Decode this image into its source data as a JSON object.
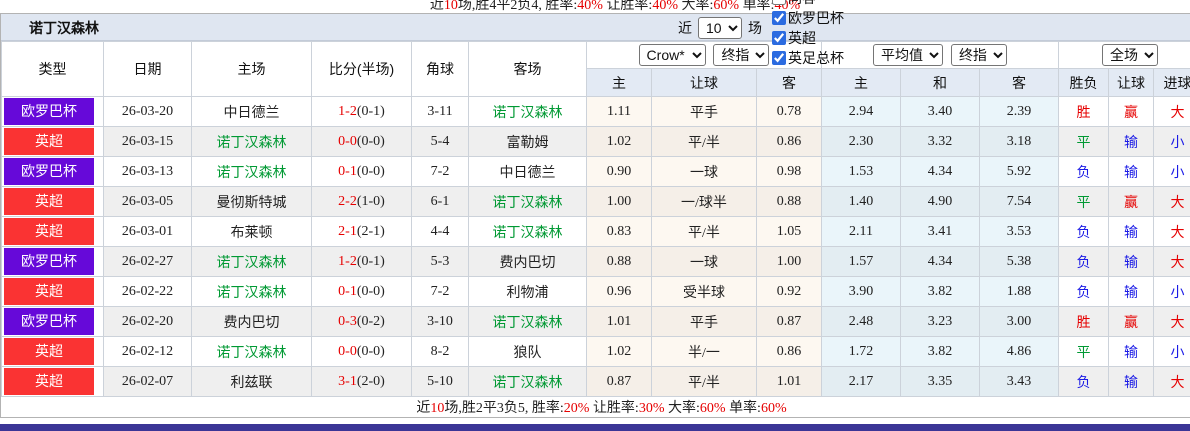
{
  "colors": {
    "league_europa": "#6609d9",
    "league_premier": "#fa3333",
    "focus_team_green": "#009933",
    "score_red": "#e60000",
    "result_red": "#e60000",
    "result_green": "#009933",
    "result_blue": "#1a1ae6",
    "header_bg": "#e3eaf4",
    "title_bar_bg": "#dfe6f1",
    "alt_row_bg": "#efefef",
    "crow_col_bg": "#fdf8f1",
    "avg_col_bg": "#eaf5fa",
    "bottom_bar": "#3b3596"
  },
  "top_clipped_line": {
    "segments": [
      {
        "t": "近",
        "c": "k"
      },
      {
        "t": "10",
        "c": "r"
      },
      {
        "t": "场,胜4平2负4, 胜率:",
        "c": "k"
      },
      {
        "t": "40%",
        "c": "r"
      },
      {
        "t": " 让胜率:",
        "c": "k"
      },
      {
        "t": "40%",
        "c": "r"
      },
      {
        "t": " 大率:",
        "c": "k"
      },
      {
        "t": "60%",
        "c": "r"
      },
      {
        "t": " 单率:",
        "c": "k"
      },
      {
        "t": "40%",
        "c": "r"
      }
    ]
  },
  "title_bar": {
    "team_name": "诺丁汉森林",
    "recent_label": "近",
    "recent_value": "10",
    "matches_label": "场",
    "checkboxes": [
      {
        "name": "same-away",
        "label": "同客",
        "checked": false
      },
      {
        "name": "europa-cup",
        "label": "欧罗巴杯",
        "checked": true
      },
      {
        "name": "premier-league",
        "label": "英超",
        "checked": true
      },
      {
        "name": "fa-cup",
        "label": "英足总杯",
        "checked": true
      }
    ]
  },
  "selects": {
    "bookmaker": "Crow*",
    "bookmaker_stage": "终指",
    "average": "平均值",
    "average_stage": "终指",
    "scope": "全场"
  },
  "columns": {
    "left": [
      "类型",
      "日期",
      "主场",
      "比分(半场)",
      "角球",
      "客场"
    ],
    "sub": [
      "主",
      "让球",
      "客",
      "主",
      "和",
      "客",
      "胜负",
      "让球",
      "进球"
    ]
  },
  "rows": [
    {
      "league": "欧罗巴杯",
      "lt": "europa",
      "date": "26-03-20",
      "home": "中日德兰",
      "home_focus": false,
      "ft": "1-2",
      "ht": "(0-1)",
      "corners": "3-11",
      "away": "诺丁汉森林",
      "away_focus": true,
      "crow": [
        "1.11",
        "平手",
        "0.78"
      ],
      "avg": [
        "2.94",
        "3.40",
        "2.39"
      ],
      "res": [
        [
          "胜",
          "red"
        ],
        [
          "赢",
          "red"
        ],
        [
          "大",
          "red"
        ]
      ]
    },
    {
      "league": "英超",
      "lt": "epl",
      "date": "26-03-15",
      "home": "诺丁汉森林",
      "home_focus": true,
      "ft": "0-0",
      "ht": "(0-0)",
      "corners": "5-4",
      "away": "富勒姆",
      "away_focus": false,
      "crow": [
        "1.02",
        "平/半",
        "0.86"
      ],
      "avg": [
        "2.30",
        "3.32",
        "3.18"
      ],
      "res": [
        [
          "平",
          "green"
        ],
        [
          "输",
          "blue"
        ],
        [
          "小",
          "blue"
        ]
      ]
    },
    {
      "league": "欧罗巴杯",
      "lt": "europa",
      "date": "26-03-13",
      "home": "诺丁汉森林",
      "home_focus": true,
      "ft": "0-1",
      "ht": "(0-0)",
      "corners": "7-2",
      "away": "中日德兰",
      "away_focus": false,
      "crow": [
        "0.90",
        "一球",
        "0.98"
      ],
      "avg": [
        "1.53",
        "4.34",
        "5.92"
      ],
      "res": [
        [
          "负",
          "blue"
        ],
        [
          "输",
          "blue"
        ],
        [
          "小",
          "blue"
        ]
      ]
    },
    {
      "league": "英超",
      "lt": "epl",
      "date": "26-03-05",
      "home": "曼彻斯特城",
      "home_focus": false,
      "ft": "2-2",
      "ht": "(1-0)",
      "corners": "6-1",
      "away": "诺丁汉森林",
      "away_focus": true,
      "crow": [
        "1.00",
        "一/球半",
        "0.88"
      ],
      "avg": [
        "1.40",
        "4.90",
        "7.54"
      ],
      "res": [
        [
          "平",
          "green"
        ],
        [
          "赢",
          "red"
        ],
        [
          "大",
          "red"
        ]
      ]
    },
    {
      "league": "英超",
      "lt": "epl",
      "date": "26-03-01",
      "home": "布莱顿",
      "home_focus": false,
      "ft": "2-1",
      "ht": "(2-1)",
      "corners": "4-4",
      "away": "诺丁汉森林",
      "away_focus": true,
      "crow": [
        "0.83",
        "平/半",
        "1.05"
      ],
      "avg": [
        "2.11",
        "3.41",
        "3.53"
      ],
      "res": [
        [
          "负",
          "blue"
        ],
        [
          "输",
          "blue"
        ],
        [
          "大",
          "red"
        ]
      ]
    },
    {
      "league": "欧罗巴杯",
      "lt": "europa",
      "date": "26-02-27",
      "home": "诺丁汉森林",
      "home_focus": true,
      "ft": "1-2",
      "ht": "(0-1)",
      "corners": "5-3",
      "away": "费内巴切",
      "away_focus": false,
      "crow": [
        "0.88",
        "一球",
        "1.00"
      ],
      "avg": [
        "1.57",
        "4.34",
        "5.38"
      ],
      "res": [
        [
          "负",
          "blue"
        ],
        [
          "输",
          "blue"
        ],
        [
          "大",
          "red"
        ]
      ]
    },
    {
      "league": "英超",
      "lt": "epl",
      "date": "26-02-22",
      "home": "诺丁汉森林",
      "home_focus": true,
      "ft": "0-1",
      "ht": "(0-0)",
      "corners": "7-2",
      "away": "利物浦",
      "away_focus": false,
      "crow": [
        "0.96",
        "受半球",
        "0.92"
      ],
      "avg": [
        "3.90",
        "3.82",
        "1.88"
      ],
      "res": [
        [
          "负",
          "blue"
        ],
        [
          "输",
          "blue"
        ],
        [
          "小",
          "blue"
        ]
      ]
    },
    {
      "league": "欧罗巴杯",
      "lt": "europa",
      "date": "26-02-20",
      "home": "费内巴切",
      "home_focus": false,
      "ft": "0-3",
      "ht": "(0-2)",
      "corners": "3-10",
      "away": "诺丁汉森林",
      "away_focus": true,
      "crow": [
        "1.01",
        "平手",
        "0.87"
      ],
      "avg": [
        "2.48",
        "3.23",
        "3.00"
      ],
      "res": [
        [
          "胜",
          "red"
        ],
        [
          "赢",
          "red"
        ],
        [
          "大",
          "red"
        ]
      ]
    },
    {
      "league": "英超",
      "lt": "epl",
      "date": "26-02-12",
      "home": "诺丁汉森林",
      "home_focus": true,
      "ft": "0-0",
      "ht": "(0-0)",
      "corners": "8-2",
      "away": "狼队",
      "away_focus": false,
      "crow": [
        "1.02",
        "半/一",
        "0.86"
      ],
      "avg": [
        "1.72",
        "3.82",
        "4.86"
      ],
      "res": [
        [
          "平",
          "green"
        ],
        [
          "输",
          "blue"
        ],
        [
          "小",
          "blue"
        ]
      ]
    },
    {
      "league": "英超",
      "lt": "epl",
      "date": "26-02-07",
      "home": "利兹联",
      "home_focus": false,
      "ft": "3-1",
      "ht": "(2-0)",
      "corners": "5-10",
      "away": "诺丁汉森林",
      "away_focus": true,
      "crow": [
        "0.87",
        "平/半",
        "1.01"
      ],
      "avg": [
        "2.17",
        "3.35",
        "3.43"
      ],
      "res": [
        [
          "负",
          "blue"
        ],
        [
          "输",
          "blue"
        ],
        [
          "大",
          "red"
        ]
      ]
    }
  ],
  "footer": {
    "segments": [
      {
        "t": "近",
        "c": "k"
      },
      {
        "t": "10",
        "c": "r"
      },
      {
        "t": "场,胜2平3负5, 胜率:",
        "c": "k"
      },
      {
        "t": "20%",
        "c": "r"
      },
      {
        "t": " 让胜率:",
        "c": "k"
      },
      {
        "t": "30%",
        "c": "r"
      },
      {
        "t": " 大率:",
        "c": "k"
      },
      {
        "t": "60%",
        "c": "r"
      },
      {
        "t": " 单率:",
        "c": "k"
      },
      {
        "t": "60%",
        "c": "r"
      }
    ]
  }
}
